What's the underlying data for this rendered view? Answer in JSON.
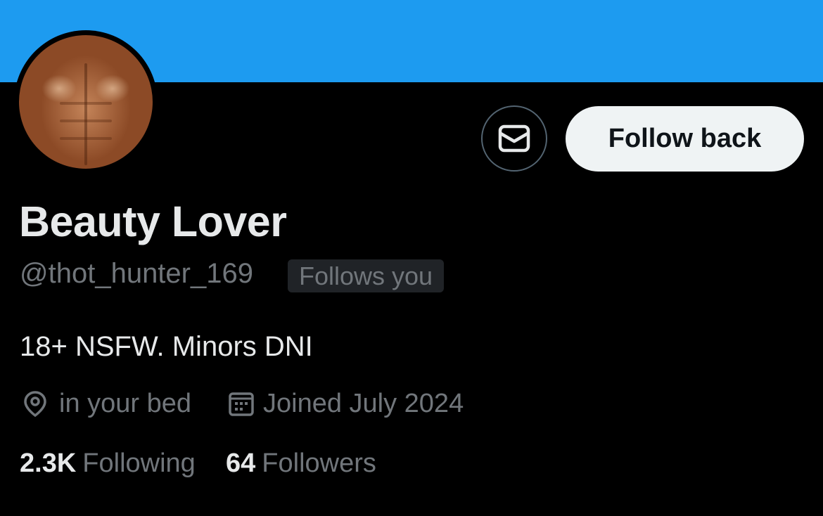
{
  "colors": {
    "banner": "#1d9bf0",
    "background": "#000000",
    "primary_text": "#e7e9ea",
    "secondary_text": "#71767b",
    "button_bg": "#eff3f4",
    "badge_bg": "#202327"
  },
  "profile": {
    "display_name": "Beauty Lover",
    "handle": "@thot_hunter_169",
    "follows_you_badge": "Follows you",
    "bio": "18+ NSFW. Minors DNI",
    "location": "in your bed",
    "joined": "Joined July 2024"
  },
  "actions": {
    "message_icon": "envelope-icon",
    "follow_label": "Follow back"
  },
  "stats": {
    "following_count": "2.3K",
    "following_label": "Following",
    "followers_count": "64",
    "followers_label": "Followers"
  },
  "icons": {
    "location": "map-pin-icon",
    "joined": "calendar-icon"
  }
}
